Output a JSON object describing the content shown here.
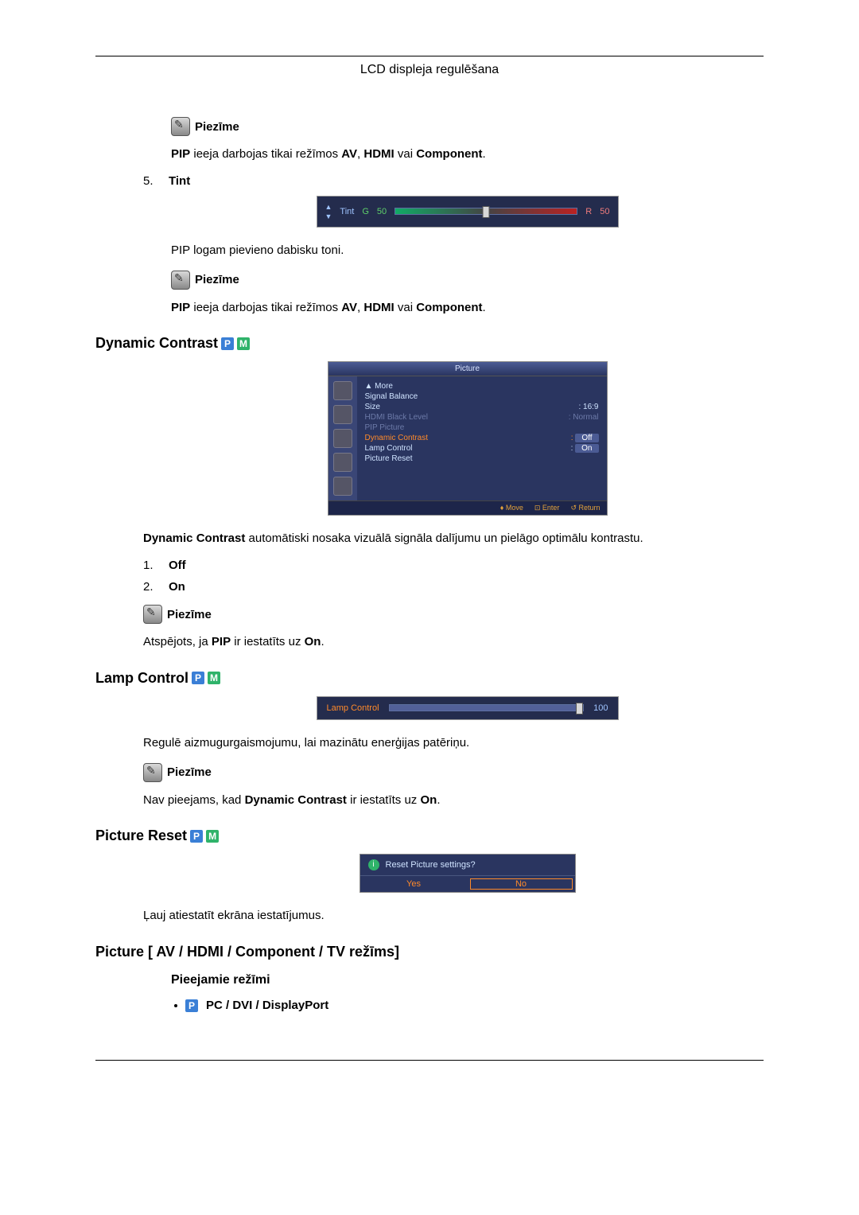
{
  "header": {
    "title": "LCD displeja regulēšana"
  },
  "note1": {
    "label": "Piezīme",
    "text_pre": "PIP",
    "text_mid": " ieeja darbojas tikai režīmos ",
    "av": "AV",
    "sep1": ", ",
    "hdmi": "HDMI",
    "sep2": " vai ",
    "component": "Component",
    "end": "."
  },
  "item5": {
    "num": "5.",
    "label": "Tint"
  },
  "osd_tint": {
    "label": "Tint",
    "g": "G",
    "g_val": "50",
    "r": "R",
    "r_val": "50"
  },
  "tint_line": "PIP logam pievieno dabisku toni.",
  "note2": {
    "label": "Piezīme",
    "text_pre": "PIP",
    "text_mid": " ieeja darbojas tikai režīmos ",
    "av": "AV",
    "sep1": ", ",
    "hdmi": "HDMI",
    "sep2": " vai ",
    "component": "Component",
    "end": "."
  },
  "dynamic_contrast": {
    "heading": "Dynamic Contrast",
    "desc_pre": "Dynamic Contrast",
    "desc_rest": " automātiski nosaka vizuālā signāla dalījumu un pielāgo optimālu kon­trastu.",
    "list1_num": "1.",
    "list1": "Off",
    "list2_num": "2.",
    "list2": "On"
  },
  "osd_picture": {
    "title": "Picture",
    "more": "▲ More",
    "rows": [
      {
        "l": "Signal Balance",
        "r": ""
      },
      {
        "l": "Size",
        "r": ": 16:9"
      },
      {
        "l": "HDMI Black Level",
        "r": ": Normal",
        "dim": true
      },
      {
        "l": "PIP Picture",
        "r": "",
        "dim": true
      },
      {
        "l": "Dynamic Contrast",
        "r": "Off",
        "hl": true,
        "sel": true,
        "colon": ":"
      },
      {
        "l": "Lamp Control",
        "r": "On",
        "colon": ":"
      },
      {
        "l": "Picture Reset",
        "r": ""
      }
    ],
    "footer": {
      "move": "Move",
      "enter": "Enter",
      "return": "Return"
    }
  },
  "note3": {
    "label": "Piezīme",
    "pre": "Atspējots, ja ",
    "pip": "PIP",
    "mid": " ir iestatīts uz ",
    "on": "On",
    "end": "."
  },
  "lamp_control": {
    "heading": "Lamp Control",
    "desc": "Regulē aizmugurgaismojumu, lai mazinātu enerģijas patēriņu."
  },
  "osd_lamp": {
    "label": "Lamp Control",
    "value": "100"
  },
  "note4": {
    "label": "Piezīme",
    "pre": "Nav pieejams, kad ",
    "dc": "Dynamic Contrast",
    "mid": " ir iestatīts uz ",
    "on": "On",
    "end": "."
  },
  "picture_reset": {
    "heading": "Picture Reset",
    "desc": "Ļauj atiestatīt ekrāna iestatījumus."
  },
  "osd_reset": {
    "question": "Reset Picture settings?",
    "yes": "Yes",
    "no": "No"
  },
  "picture_mode": {
    "heading": "Picture [ AV / HDMI / Component / TV režīms]",
    "sub": "Pieejamie režīmi",
    "bullet1": "PC / DVI / DisplayPort"
  }
}
